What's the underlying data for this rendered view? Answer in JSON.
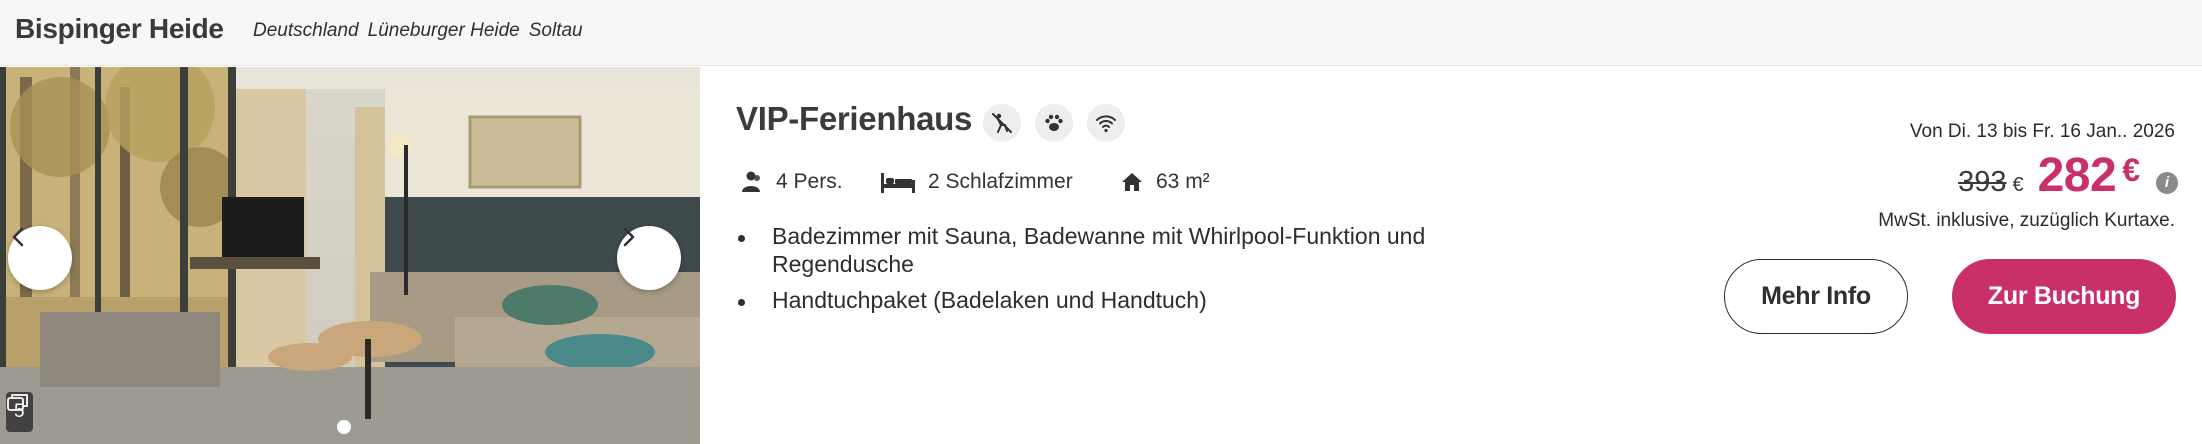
{
  "header": {
    "park_name": "Bispinger Heide",
    "breadcrumb": [
      "Deutschland",
      "Lüneburger Heide",
      "Soltau"
    ]
  },
  "gallery": {
    "photo_count": "5",
    "prev_icon": "chevron-left-icon",
    "next_icon": "chevron-right-icon",
    "slides_total": 1,
    "active_slide": 1
  },
  "listing": {
    "title": "VIP-Ferienhaus",
    "amenities": [
      {
        "icon": "no-smoking-icon"
      },
      {
        "icon": "pet-paw-icon"
      },
      {
        "icon": "wifi-icon"
      }
    ],
    "facts": {
      "persons": "4 Pers.",
      "bedrooms": "2 Schlafzimmer",
      "area": "63 m²"
    },
    "features": [
      "Badezimmer mit Sauna, Badewanne mit Whirlpool-Funktion und Regendusche",
      "Handtuchpaket (Badelaken und Handtuch)"
    ]
  },
  "pricing": {
    "dates": "Von Di. 13 bis Fr. 16 Jan.. 2026",
    "old_price": "393",
    "old_currency": "€",
    "new_price": "282",
    "new_currency": "€",
    "info_glyph": "i",
    "tax_note": "MwSt. inklusive, zuzüglich Kurtaxe."
  },
  "actions": {
    "more_info": "Mehr Info",
    "book": "Zur Buchung"
  },
  "colors": {
    "accent": "#c9306a",
    "header_bg": "#f7f7f5",
    "text": "#2b2b2b"
  }
}
